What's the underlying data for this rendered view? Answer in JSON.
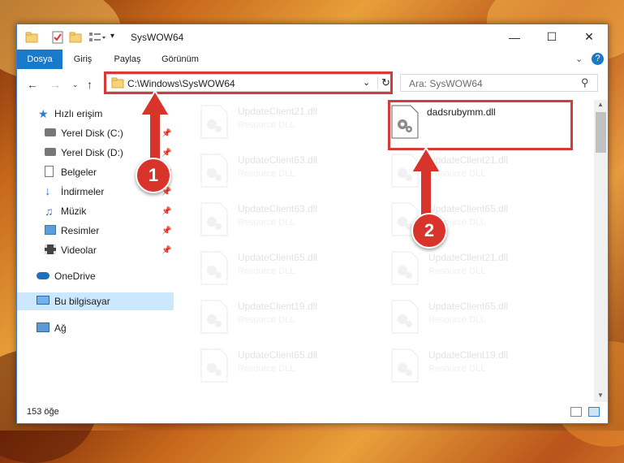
{
  "window": {
    "title": "SysWOW64",
    "ribbon_tabs": [
      "Dosya",
      "Giriş",
      "Paylaş",
      "Görünüm"
    ],
    "address": "C:\\Windows\\SysWOW64",
    "search_placeholder": "Ara: SysWOW64"
  },
  "sidebar": {
    "items": [
      {
        "label": "Hızlı erişim",
        "icon": "star-icon"
      },
      {
        "label": "Yerel Disk (C:)",
        "icon": "drive-icon",
        "pinned": true
      },
      {
        "label": "Yerel Disk (D:)",
        "icon": "drive-icon",
        "pinned": true
      },
      {
        "label": "Belgeler",
        "icon": "documents-icon",
        "pinned": true
      },
      {
        "label": "İndirmeler",
        "icon": "download-icon",
        "pinned": true
      },
      {
        "label": "Müzik",
        "icon": "music-icon",
        "pinned": true
      },
      {
        "label": "Resimler",
        "icon": "pictures-icon",
        "pinned": true
      },
      {
        "label": "Videolar",
        "icon": "videos-icon",
        "pinned": true
      },
      {
        "label": "OneDrive",
        "icon": "cloud-icon"
      },
      {
        "label": "Bu bilgisayar",
        "icon": "computer-icon",
        "selected": true
      },
      {
        "label": "Ağ",
        "icon": "network-icon"
      }
    ]
  },
  "files": {
    "left_column": [
      {
        "name": "UpdateClient21.dll",
        "type": "Resource DLL"
      },
      {
        "name": "UpdateClient63.dll",
        "type": "Resource DLL"
      },
      {
        "name": "UpdateClient63.dll",
        "type": "Resource DLL"
      },
      {
        "name": "UpdateClient65.dll",
        "type": "Resource DLL"
      },
      {
        "name": "UpdateClient19.dll",
        "type": "Resource DLL"
      },
      {
        "name": "UpdateClient65.dll",
        "type": "Resource DLL"
      }
    ],
    "right_column": [
      {
        "name": "dadsrubymm.dll",
        "type": ""
      },
      {
        "name": "UpdateClient21.dll",
        "type": "Resource DLL"
      },
      {
        "name": "UpdateClient65.dll",
        "type": "Resource DLL"
      },
      {
        "name": "UpdateClient21.dll",
        "type": "Resource DLL"
      },
      {
        "name": "UpdateClient65.dll",
        "type": "Resource DLL"
      },
      {
        "name": "UpdateClient19.dll",
        "type": "Resource DLL"
      }
    ]
  },
  "status": {
    "item_count": "153 öğe"
  },
  "annotations": {
    "badge1": "1",
    "badge2": "2",
    "color": "#d83a3a"
  }
}
